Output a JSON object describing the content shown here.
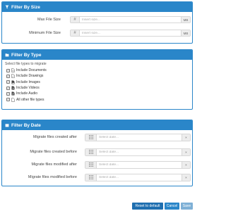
{
  "size_panel": {
    "title": "Filter By Size",
    "max_label": "Max File Size",
    "max_placeholder": "Insert size...",
    "max_unit": "MB",
    "min_label": "Minimum File Size",
    "min_placeholder": "Insert size...",
    "min_unit": "MB"
  },
  "type_panel": {
    "title": "Filter By Type",
    "intro": "Select file types to migrate",
    "items": [
      {
        "label": "Include Documents",
        "checked": true,
        "icon": "document-icon"
      },
      {
        "label": "Include Drawings",
        "checked": true,
        "icon": "drawing-icon"
      },
      {
        "label": "Include Images",
        "checked": true,
        "icon": "image-icon"
      },
      {
        "label": "Include Videos",
        "checked": true,
        "icon": "video-icon"
      },
      {
        "label": "Include Audio",
        "checked": true,
        "icon": "audio-icon"
      },
      {
        "label": "All other file types",
        "checked": true,
        "icon": "file-icon"
      }
    ]
  },
  "date_panel": {
    "title": "Filter By Date",
    "rows": [
      {
        "label": "Migrate files created after",
        "placeholder": "Select date..."
      },
      {
        "label": "Migrate files created before",
        "placeholder": "Select date..."
      },
      {
        "label": "Migrate files modified after",
        "placeholder": "Select date..."
      },
      {
        "label": "Migrate files modified before",
        "placeholder": "Select date..."
      }
    ]
  },
  "buttons": {
    "reset": "Reset to default",
    "cancel": "Cancel",
    "save": "Save"
  },
  "colors": {
    "header_blue": "#2a86c9",
    "reset_blue": "#1f6fb0",
    "save_disabled": "#7eb0d6"
  }
}
